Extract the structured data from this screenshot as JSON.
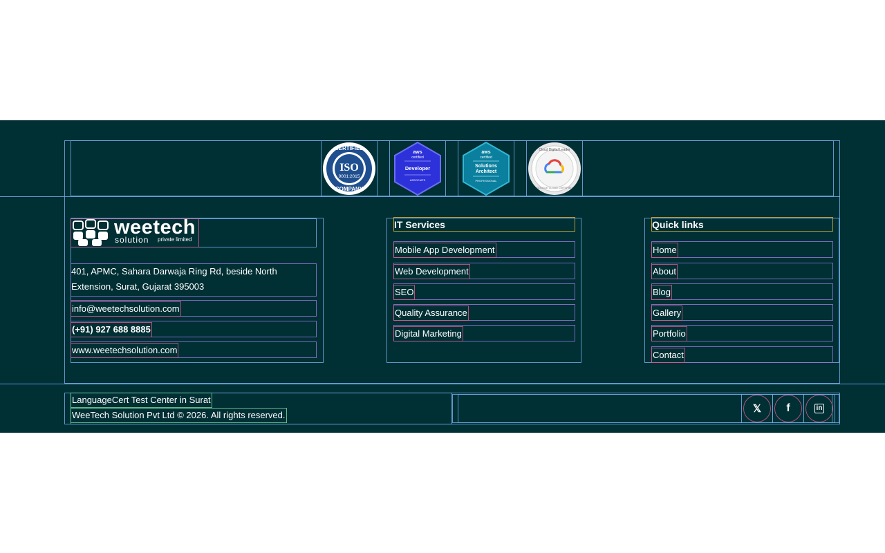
{
  "badges": [
    {
      "name": "iso-certified-company-badge",
      "line1": "CERTIFIED",
      "line2": "ISO",
      "line3": "9001:2015",
      "line4": "COMPANY"
    },
    {
      "name": "aws-developer-associate-badge",
      "line1": "aws",
      "line2": "certified",
      "line3": "Developer",
      "line4": "ASSOCIATE"
    },
    {
      "name": "aws-solutions-architect-badge",
      "line1": "aws",
      "line2": "certified",
      "line3": "Solutions",
      "line3b": "Architect",
      "line4": "PROFESSIONAL"
    },
    {
      "name": "google-cloud-digital-leader-badge",
      "line1": "Cloud Digital Leader",
      "line4": "GOOGLE CLOUD CERTIFIED"
    }
  ],
  "brand": {
    "name": "weetech",
    "sub": "solution",
    "sub2": "private limited"
  },
  "contact": {
    "address": "401, APMC, Sahara Darwaja Ring Rd, beside North Extension, Surat, Gujarat 395003",
    "email": "info@weetechsolution.com",
    "phone": "(+91) 927 688 8885",
    "website": "www.weetechsolution.com"
  },
  "services": {
    "title": "IT Services",
    "items": [
      "Mobile App Development",
      "Web Development",
      "SEO",
      "Quality Assurance",
      "Digital Marketing"
    ]
  },
  "quicklinks": {
    "title": "Quick links",
    "items": [
      "Home",
      "About",
      "Blog",
      "Gallery",
      "Portfolio",
      "Contact"
    ]
  },
  "bottom": {
    "line1": "LanguageCert Test Center in Surat",
    "line2": "WeeTech Solution Pvt Ltd © 2026. All rights reserved."
  },
  "social": [
    {
      "name": "x-twitter-icon",
      "glyph": "𝕏"
    },
    {
      "name": "facebook-icon",
      "glyph": "f"
    },
    {
      "name": "linkedin-icon",
      "glyph": "in"
    }
  ],
  "colors": {
    "footer_bg": "#002f34",
    "text": "#ffffff"
  }
}
